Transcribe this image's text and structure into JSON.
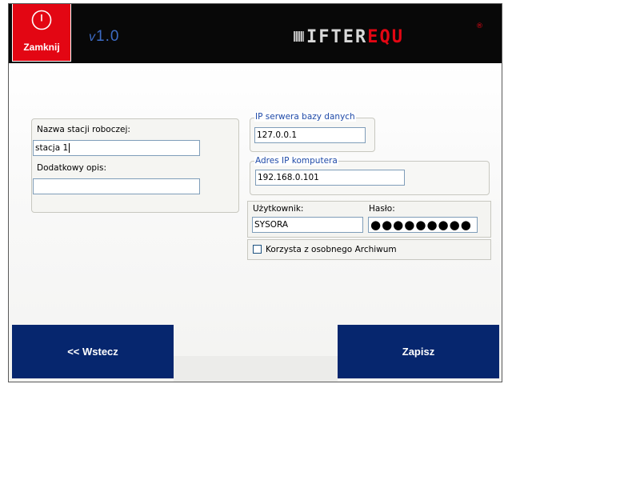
{
  "header": {
    "close_label": "Zamknij",
    "version_prefix": "v",
    "version_number": "1.0",
    "logo_main": "IFTER",
    "logo_accent": "EQU",
    "logo_reg": "®",
    "power_icon": "power-icon",
    "colors": {
      "bar": "#080808",
      "close_bg": "#e30613",
      "version": "#3d6bc4"
    }
  },
  "station": {
    "name_label": "Nazwa stacji roboczej:",
    "name_value": "stacja 1",
    "desc_label": "Dodatkowy opis:",
    "desc_value": ""
  },
  "db_server": {
    "group_label": "IP serwera bazy danych",
    "ip_value": "127.0.0.1"
  },
  "computer": {
    "group_label": "Adres IP komputera",
    "ip_value": "192.168.0.101"
  },
  "credentials": {
    "user_label": "Użytkownik:",
    "user_value": "SYSORA",
    "password_label": "Hasło:",
    "password_value": "●●●●●●●●●"
  },
  "archive": {
    "checkbox_label": "Korzysta z osobnego Archiwum",
    "checked": false
  },
  "footer": {
    "back_label": "<< Wstecz",
    "save_label": "Zapisz",
    "colors": {
      "button": "#06266e"
    }
  }
}
